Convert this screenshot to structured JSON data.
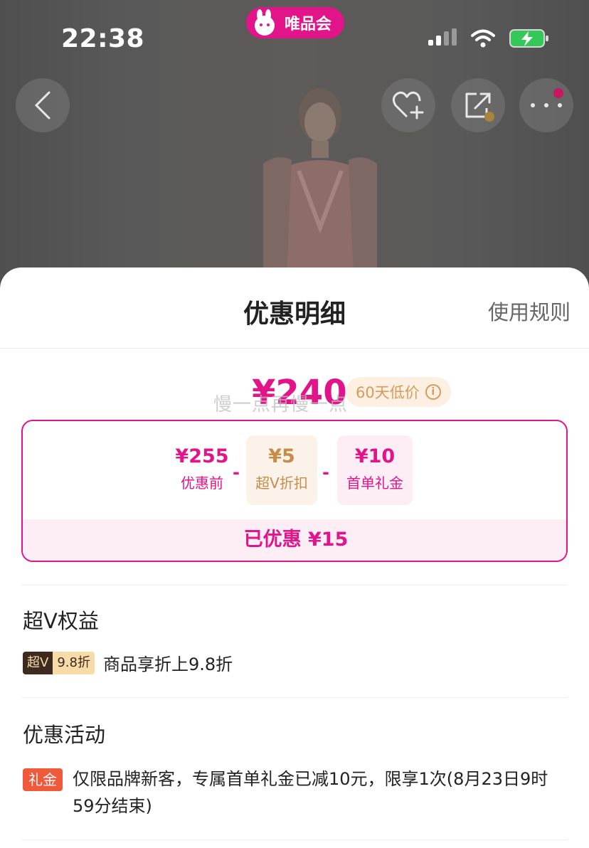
{
  "status_bar": {
    "time": "22:38",
    "app_name": "唯品会"
  },
  "sheet": {
    "title": "优惠明细",
    "rules_link": "使用规则"
  },
  "price": {
    "final": "¥240",
    "low_badge": "60天低价",
    "toast": "慢一点再慢一点"
  },
  "breakdown": {
    "items": [
      {
        "amount": "¥255",
        "label": "优惠前"
      },
      {
        "amount": "¥5",
        "label": "超V折扣"
      },
      {
        "amount": "¥10",
        "label": "首单礼金"
      }
    ],
    "minus": "-",
    "total": "已优惠 ¥15"
  },
  "superv": {
    "title": "超V权益",
    "tag_left": "超V",
    "tag_right": "9.8折",
    "text": "商品享折上9.8折"
  },
  "promotions": {
    "title": "优惠活动",
    "tag": "礼金",
    "text": "仅限品牌新客，专属首单礼金已减10元，限享1次(8月23日9时59分结束)"
  },
  "colors": {
    "brand": "#e1148a",
    "gold": "#c98b4a",
    "orange": "#f05a3a",
    "dim_bg": "#5b5b5b"
  },
  "icons": [
    "back-icon",
    "heart-plus-icon",
    "share-icon",
    "more-icon",
    "wifi-icon",
    "signal-icon",
    "battery-charging-icon",
    "info-icon"
  ]
}
